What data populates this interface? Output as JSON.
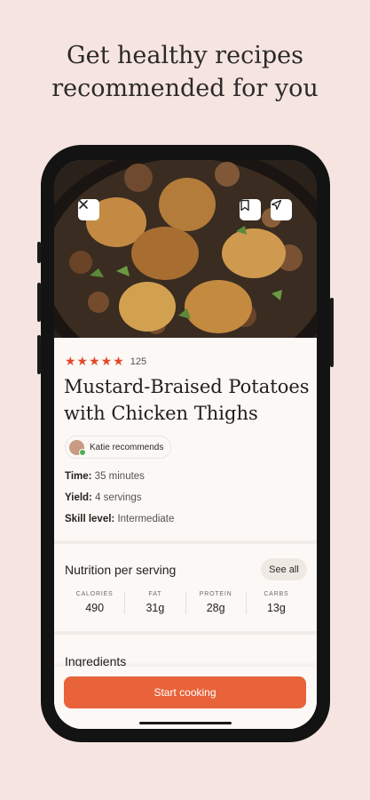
{
  "headline": "Get healthy recipes\nrecommended for you",
  "photo": {
    "close_icon": "close-icon",
    "bookmark_icon": "bookmark-icon",
    "share_icon": "send-icon"
  },
  "recipe": {
    "stars": "★★★★★",
    "rating": 5,
    "rating_count": "125",
    "title": "Mustard-Braised Potatoes with Chicken Thighs",
    "recommended_by": "Katie recommends",
    "time_label": "Time:",
    "time_value": "35 minutes",
    "yield_label": "Yield:",
    "yield_value": "4 servings",
    "skill_label": "Skill level:",
    "skill_value": "Intermediate"
  },
  "nutrition": {
    "title": "Nutrition per serving",
    "see_all": "See all",
    "items": [
      {
        "label": "CALORIES",
        "value": "490"
      },
      {
        "label": "FAT",
        "value": "31g"
      },
      {
        "label": "PROTEIN",
        "value": "28g"
      },
      {
        "label": "CARBS",
        "value": "13g"
      }
    ]
  },
  "ingredients_title": "Ingredients",
  "cta_label": "Start cooking",
  "colors": {
    "background": "#f6e4e1",
    "accent": "#e8633a",
    "stars": "#e2492b"
  }
}
